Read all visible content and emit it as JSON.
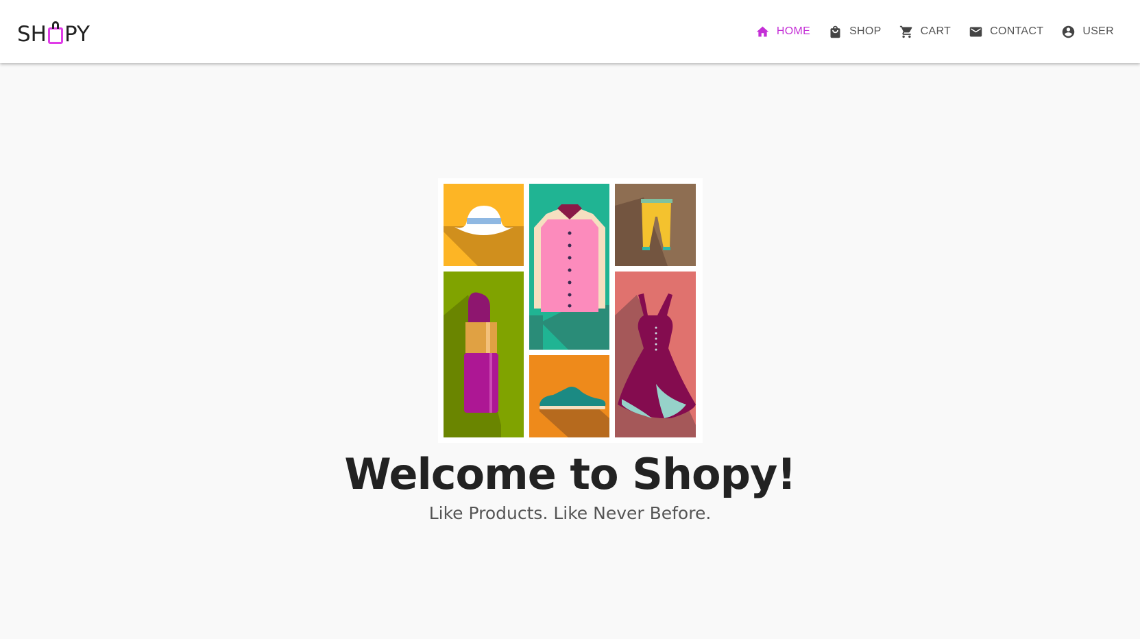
{
  "app": {
    "logo_text_left": "SH",
    "logo_text_right": "PY",
    "accent_color": "#c42fd6"
  },
  "nav": {
    "items": [
      {
        "label": "HOME",
        "icon": "home-icon",
        "active": true
      },
      {
        "label": "SHOP",
        "icon": "shopping-bag-icon",
        "active": false
      },
      {
        "label": "CART",
        "icon": "cart-icon",
        "active": false
      },
      {
        "label": "CONTACT",
        "icon": "mail-icon",
        "active": false
      },
      {
        "label": "USER",
        "icon": "account-circle-icon",
        "active": false
      }
    ]
  },
  "hero": {
    "image_tiles": [
      "hat",
      "shirt",
      "pants",
      "lipstick",
      "shoe",
      "dress"
    ],
    "title": "Welcome to Shopy!",
    "subtitle": "Like Products. Like Never Before."
  }
}
